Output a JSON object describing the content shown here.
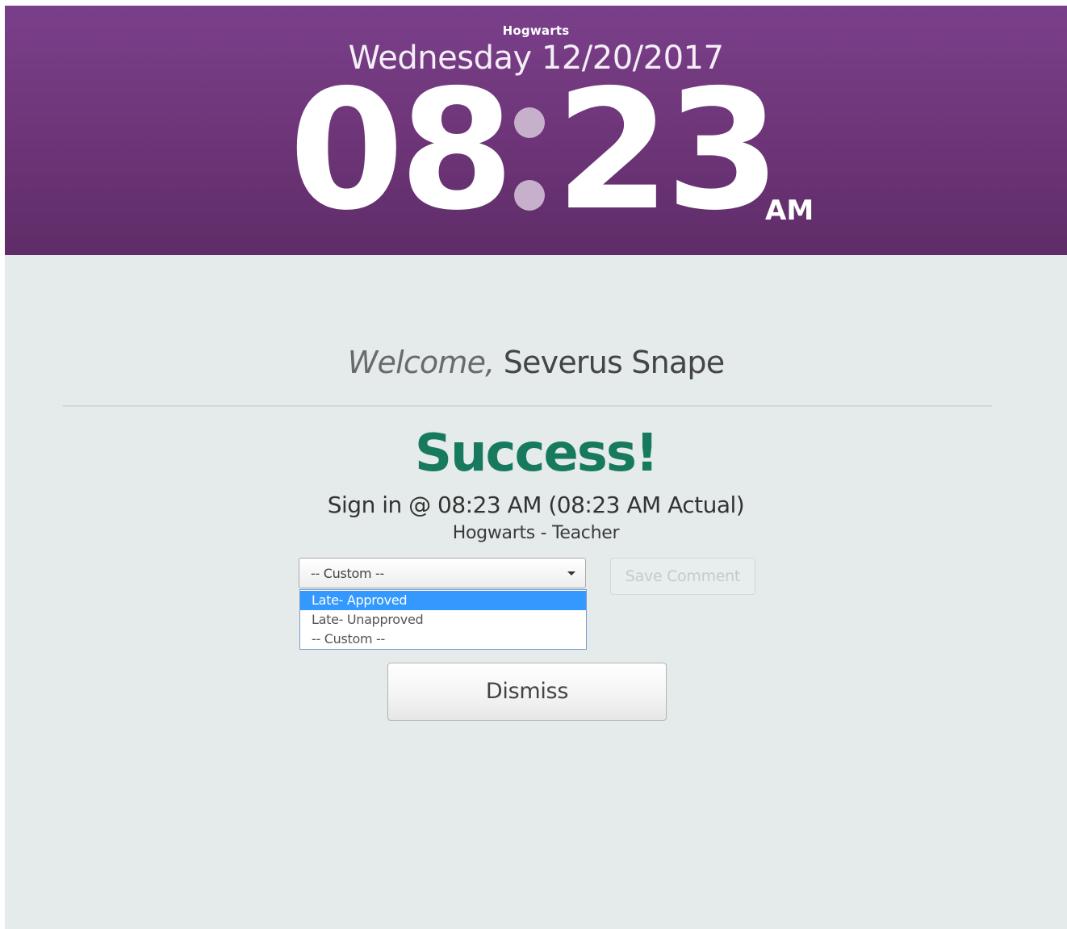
{
  "header": {
    "organization": "Hogwarts",
    "date": "Wednesday 12/20/2017",
    "clock": {
      "hours": "08",
      "minutes": "23",
      "ampm": "AM"
    }
  },
  "welcome": {
    "label": "Welcome,",
    "name": "Severus Snape"
  },
  "result": {
    "title": "Success!",
    "sign_in_text": "Sign in @ 08:23 AM (08:23 AM Actual)",
    "location_role": "Hogwarts - Teacher"
  },
  "comment": {
    "select_value": "-- Custom --",
    "options": [
      "Late- Approved",
      "Late- Unapproved",
      "-- Custom --"
    ],
    "highlighted_option": "Late- Approved",
    "save_label": "Save Comment"
  },
  "actions": {
    "dismiss_label": "Dismiss"
  },
  "colors": {
    "header_purple": "#6d3577",
    "success_green": "#177a5e",
    "highlight_blue": "#3399ff",
    "background": "#e4ebea"
  }
}
